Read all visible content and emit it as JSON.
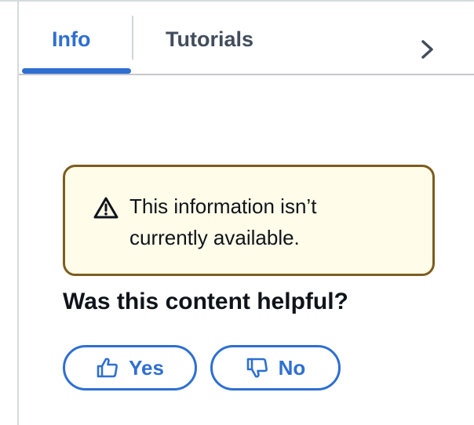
{
  "tabs": [
    {
      "label": "Info",
      "active": true
    },
    {
      "label": "Tutorials",
      "active": false
    }
  ],
  "alert": {
    "type": "warning",
    "text": "This information isn’t currently available."
  },
  "feedback": {
    "question": "Was this content helpful?",
    "yes_label": "Yes",
    "no_label": "No"
  },
  "icons": {
    "alert": "warning-icon",
    "tabs_next": "chevron-right-icon",
    "yes": "thumbs-up-icon",
    "no": "thumbs-down-icon"
  },
  "colors": {
    "accent": "#2e6fd1",
    "tab_inactive": "#414d5c",
    "warning_border": "#7d5c1f",
    "warning_background": "#fffce9",
    "text": "#0f141a"
  }
}
